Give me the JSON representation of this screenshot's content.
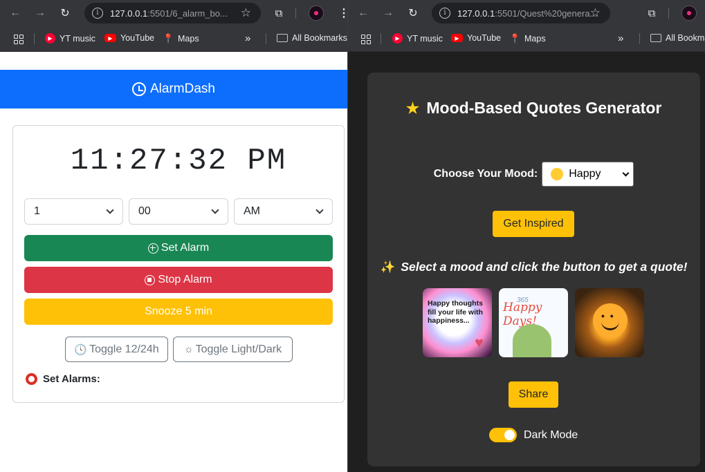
{
  "left": {
    "url_host": "127.0.0.1",
    "url_path": ":5501/6_alarm_bo...",
    "bookmarks": [
      "YT music",
      "YouTube",
      "Maps",
      "All Bookmarks"
    ],
    "app": {
      "brand": "AlarmDash",
      "time": "11:27:32 PM",
      "hour_select": "1",
      "minute_select": "00",
      "ampm_select": "AM",
      "set_alarm": "Set Alarm",
      "stop_alarm": "Stop Alarm",
      "snooze": "Snooze 5 min",
      "toggle_format": "Toggle 12/24h",
      "toggle_theme": "Toggle Light/Dark",
      "set_alarms_heading": "Set Alarms:"
    }
  },
  "right": {
    "url_host": "127.0.0.1",
    "url_path": ":5501/Quest%20genera...",
    "bookmarks": [
      "YT music",
      "YouTube",
      "Maps",
      "All Bookmarks"
    ],
    "app": {
      "title": "Mood-Based Quotes Generator",
      "mood_label": "Choose Your Mood:",
      "mood_value": "Happy",
      "get_inspired": "Get Inspired",
      "hint": "Select a mood and click the button to get a quote!",
      "thumb1_text": "Happy thoughts fill your life with happiness...",
      "thumb2_small": "365",
      "thumb2_text": "Happy Days!",
      "share": "Share",
      "dark_mode": "Dark Mode"
    }
  },
  "colors": {
    "primary": "#0d6efd",
    "success": "#198754",
    "danger": "#dc3545",
    "warning": "#ffc107"
  }
}
